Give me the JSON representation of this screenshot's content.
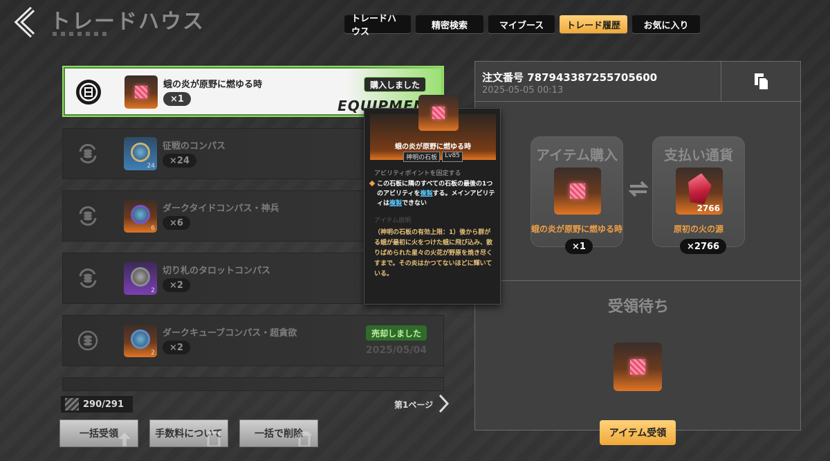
{
  "header": {
    "title": "トレードハウス",
    "tabs": [
      {
        "label": "トレードハウス",
        "active": false
      },
      {
        "label": "精密検索",
        "active": false
      },
      {
        "label": "マイブース",
        "active": false
      },
      {
        "label": "トレード履歴",
        "active": true
      },
      {
        "label": "お気に入り",
        "active": false
      }
    ]
  },
  "list": {
    "items": [
      {
        "name": "蛾の炎が原野に燃ゆる時",
        "qty": "×1",
        "status": "購入しました",
        "watermark": "EQUIPMENT",
        "selected": true
      },
      {
        "name": "征戦のコンパス",
        "qty": "×24",
        "thumb_count": "24"
      },
      {
        "name": "ダークタイドコンパス・神兵",
        "qty": "×6",
        "thumb_count": "6"
      },
      {
        "name": "切り札のタロットコンパス",
        "qty": "×2",
        "thumb_count": "2"
      },
      {
        "name": "ダークキューブコンパス・超貪欲",
        "qty": "×2",
        "thumb_count": "2",
        "status": "売却しました",
        "date": "2025/05/04"
      }
    ],
    "counter": "290/291",
    "page": "第1ページ"
  },
  "buttons": {
    "bulk_receive": "一括受領",
    "fee_info": "手数料について",
    "bulk_delete": "一括で削除"
  },
  "detail": {
    "order_no": "注文番号 787943387255705600",
    "order_date": "2025-05-05 00:13",
    "purchase_title": "アイテム購入",
    "purchase_item": "蛾の炎が原野に燃ゆる時",
    "purchase_qty": "×1",
    "currency_title": "支払い通貨",
    "currency_item": "原初の火の源",
    "currency_amount": "2766",
    "currency_qty": "×2766",
    "pending_label": "受領待ち",
    "receive_button": "アイテム受領"
  },
  "tooltip": {
    "name": "蛾の炎が原野に燃ゆる時",
    "type": "神明の石板",
    "level": "Lv85",
    "ability_header": "アビリティポイントを固定する",
    "ability_part1": "この石板に隣のすべての石板の最後の1つのアビリティを",
    "ability_link1": "複製",
    "ability_part2": "する。メインアビリティは",
    "ability_link2": "複製",
    "ability_part3": "できない",
    "desc_header": "アイテム説明",
    "desc": "（神明の石板の有効上限：1）後から群がる蛾が最初に火をつけた蛾に飛び込み、散りばめられた星々の火花が野原を焼き尽くすまで。その炎はかつてないほどに輝いている。"
  },
  "colors": {
    "accent": "#f0a93a",
    "selected_border": "#8fdc6a",
    "item_name_orange": "#f0a044",
    "link": "#58c8ff"
  }
}
